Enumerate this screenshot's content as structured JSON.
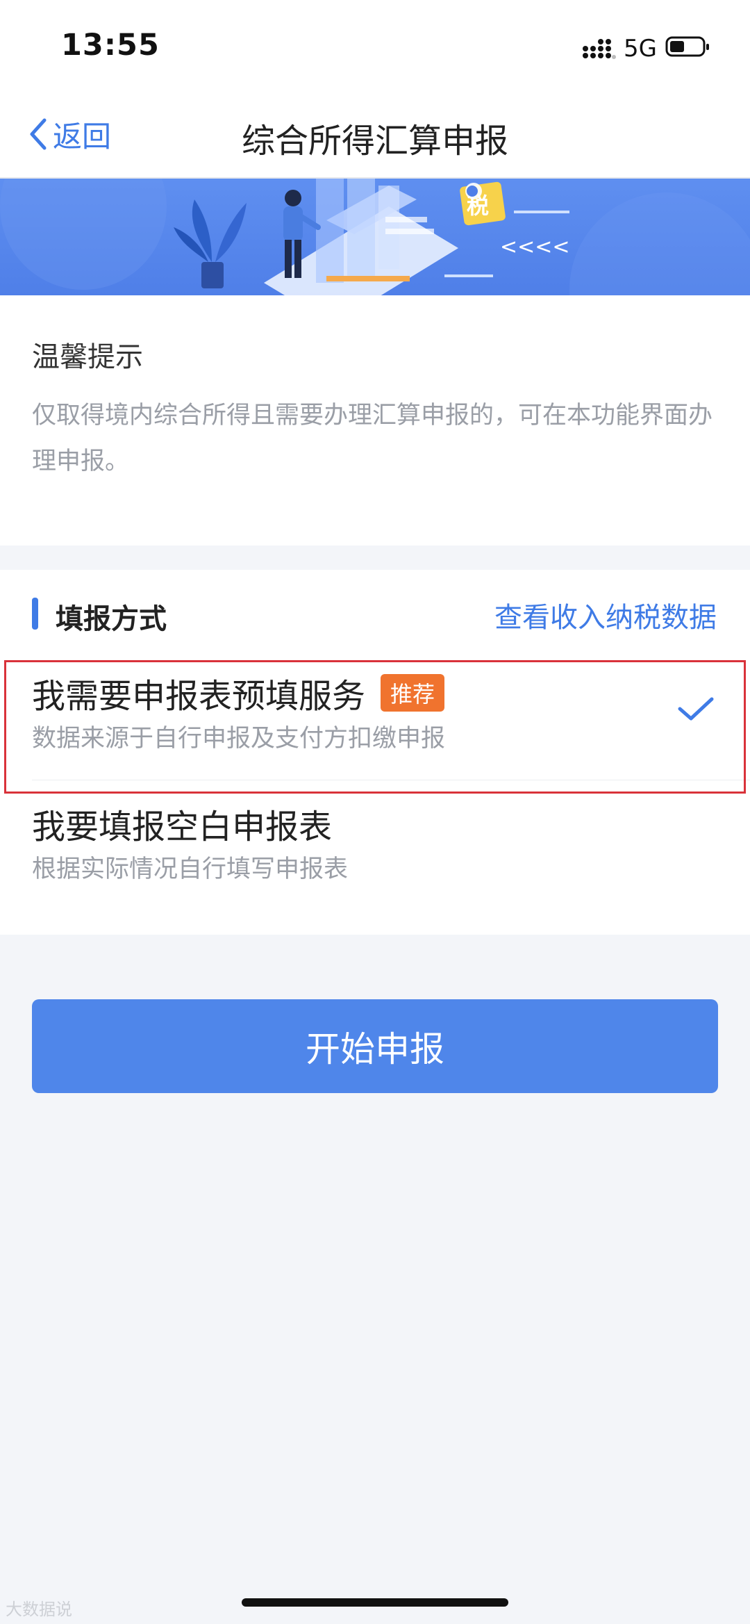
{
  "status_bar": {
    "time": "13:55",
    "network": "5G"
  },
  "nav": {
    "back_label": "返回",
    "title": "综合所得汇算申报"
  },
  "banner": {
    "tax_char": "税",
    "arrows": "<<<<"
  },
  "tip": {
    "title": "温馨提示",
    "text": "仅取得境内综合所得且需要办理汇算申报的，可在本功能界面办理申报。"
  },
  "method": {
    "section_title": "填报方式",
    "data_link": "查看收入纳税数据",
    "options": [
      {
        "title": "我需要申报表预填服务",
        "badge": "推荐",
        "desc": "数据来源于自行申报及支付方扣缴申报",
        "selected": true
      },
      {
        "title": "我要填报空白申报表",
        "desc": "根据实际情况自行填写申报表",
        "selected": false
      }
    ]
  },
  "start_button": "开始申报",
  "watermark": "大数据说",
  "colors": {
    "accent": "#3f7be6",
    "badge": "#f0732e",
    "button": "#4f86ea",
    "highlight": "#d9323a"
  }
}
